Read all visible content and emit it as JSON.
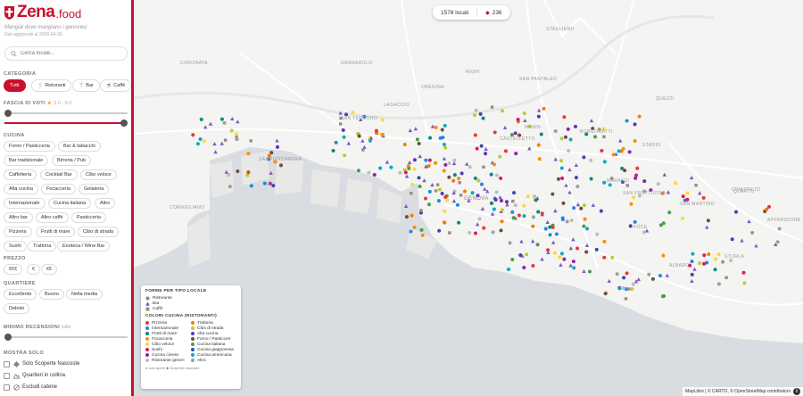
{
  "brand": {
    "name": "Zena",
    "tld": ".food",
    "subtitle": "Mangiàl dove mangiano i genovesi",
    "updated": "Dati aggiornati al 2026-04-30"
  },
  "search": {
    "placeholder": "Cerca locale..."
  },
  "categoria": {
    "label": "CATEGORIA",
    "items": [
      {
        "label": "Tutti",
        "icon": "none",
        "active": true
      },
      {
        "label": "Ristoranti",
        "icon": "fork-knife-icon",
        "active": false
      },
      {
        "label": "Bar",
        "icon": "glass-icon",
        "active": false
      },
      {
        "label": "Caffè",
        "icon": "coffee-cup-icon",
        "active": false
      }
    ]
  },
  "voti": {
    "label": "FASCIA DI VOTI",
    "hint": "3.0 - 5.0",
    "min_value": 3.0,
    "max_value": 5.0
  },
  "cucina": {
    "label": "CUCINA",
    "items": [
      "Forno / Pasticceria",
      "Bar & tabacchi",
      "Bar tradizionale",
      "Birreria / Pub",
      "Caffetteria",
      "Cocktail Bar",
      "Cibo veloce",
      "Alta cucina",
      "Focacceria",
      "Gelateria",
      "Internazionale",
      "Cucina italiana",
      "Altro",
      "Altro bar",
      "Altro caffè",
      "Pasticceria",
      "Pizzeria",
      "Frutti di mare",
      "Cibo di strada",
      "Sushi",
      "Trattoria",
      "Enoteca / Wine Bar"
    ]
  },
  "prezzo": {
    "label": "PREZZO",
    "items": [
      "€€€",
      "€",
      "€€"
    ]
  },
  "quartiere": {
    "label": "QUARTIERE",
    "items": [
      "Eccellente",
      "Buono",
      "Nella media",
      "Debole"
    ]
  },
  "recensioni": {
    "label": "MINIMO RECENSIONI",
    "hint": "tutte",
    "value": 0
  },
  "mostra": {
    "label": "MOSTRA SOLO",
    "items": [
      {
        "label": "Solo Scoperte Nascoste",
        "icon": "diamond-icon"
      },
      {
        "label": "Quartieri in collina",
        "icon": "hills-icon"
      },
      {
        "label": "Escludi catene",
        "icon": "chain-off-icon"
      }
    ]
  },
  "stats": {
    "locali": "1578 locali",
    "gems": "236"
  },
  "places": [
    "CORONATA",
    "GRANAROLO",
    "SAN TEODORO",
    "LAGACCIO",
    "OREGINA",
    "RIGHI",
    "SAN PANTALEO",
    "STAGLIENO",
    "MANIN",
    "CASTELLETTO",
    "BORGORATTI",
    "QUEZZI",
    "MARASSI",
    "SAN FRUTTUOSO",
    "SAN MARTINO",
    "QUARTO",
    "STURLA",
    "APPARIZIONE",
    "ALBARO",
    "FOCE",
    "GENOVA",
    "SAMPIERDARENA",
    "CORNIGLIANO",
    "CHIAPPETO",
    "STADIO"
  ],
  "legend": {
    "title_shapes": "FORME PER TIPO LOCALE",
    "shapes": [
      {
        "label": "Ristorante",
        "shape": "circle"
      },
      {
        "label": "Bar",
        "shape": "triangle"
      },
      {
        "label": "Caffè",
        "shape": "square"
      }
    ],
    "title_colors": "COLORI CUCINA (RISTORANTI)",
    "colors_left": [
      {
        "label": "Pizzeria",
        "color": "#e53935"
      },
      {
        "label": "Internazionale",
        "color": "#1e88e5"
      },
      {
        "label": "Frutti di mare",
        "color": "#00897b"
      },
      {
        "label": "Focacceria",
        "color": "#fb8c00"
      },
      {
        "label": "Cibo veloce",
        "color": "#fdd835"
      },
      {
        "label": "Sushi",
        "color": "#d81b60"
      },
      {
        "label": "Cucina cinese",
        "color": "#8e24aa"
      },
      {
        "label": "Ristorante generi",
        "color": "#bdbdbd"
      }
    ],
    "colors_right": [
      {
        "label": "Trattoria",
        "color": "#f57c00"
      },
      {
        "label": "Cibo di strada",
        "color": "#c0ca33"
      },
      {
        "label": "Alta cucina",
        "color": "#5e35b1"
      },
      {
        "label": "Forno / Pasticcerr",
        "color": "#6d4c41"
      },
      {
        "label": "Cucina italiana",
        "color": "#43a047"
      },
      {
        "label": "Cucina giapponese",
        "color": "#3949ab"
      },
      {
        "label": "Cucina americana",
        "color": "#00acc1"
      },
      {
        "label": "Altro",
        "color": "#9e9e9e"
      }
    ],
    "footer": "● solo aperti  ◆ Scoperte nascoste"
  },
  "attribution": "MapLibre | © CARTO, © OpenStreetMap contributors",
  "colors": {
    "accent": "#c8102e",
    "bar": "#7e57c2"
  }
}
